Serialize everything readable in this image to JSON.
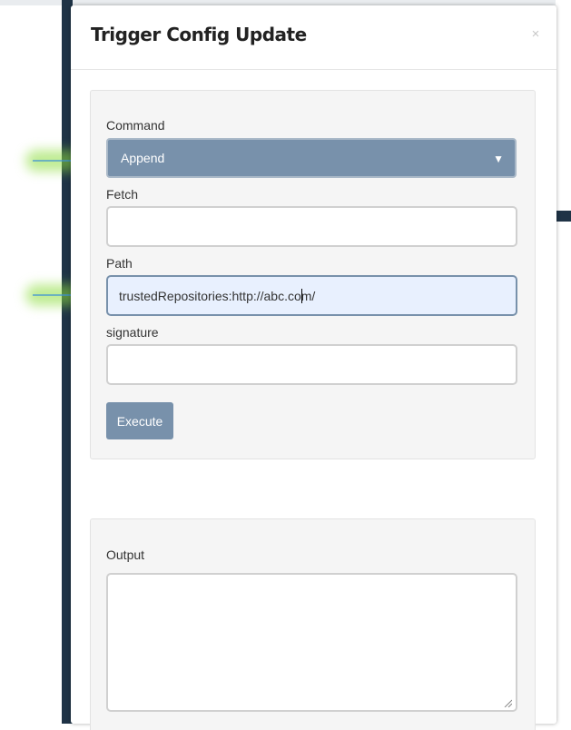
{
  "modal": {
    "title": "Trigger Config Update",
    "close_glyph": "×"
  },
  "form": {
    "command": {
      "label": "Command",
      "value": "Append",
      "caret": "▼"
    },
    "fetch": {
      "label": "Fetch",
      "value": ""
    },
    "path": {
      "label": "Path",
      "value": "trustedRepositories:http://abc.com/"
    },
    "signature": {
      "label": "signature",
      "value": ""
    },
    "execute_label": "Execute"
  },
  "output": {
    "label": "Output",
    "value": ""
  },
  "annotations": {
    "arrow_color": "#3b8fd6",
    "glow_color": "#8cdc3c",
    "forbidden_color": "#d81e1e",
    "icons": [
      "arrow-right-icon",
      "no-entry-icon"
    ]
  }
}
